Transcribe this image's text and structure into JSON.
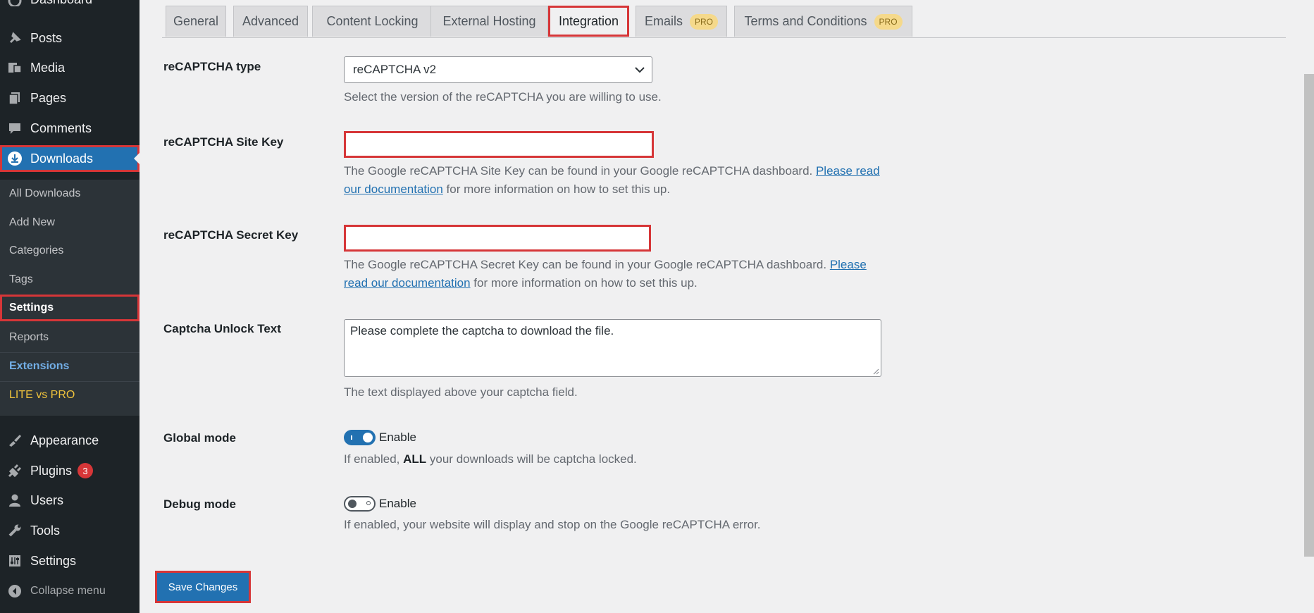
{
  "sidebar": {
    "items": [
      {
        "label": "Dashboard",
        "icon": "dashboard-icon"
      },
      {
        "label": "Posts",
        "icon": "pin-icon"
      },
      {
        "label": "Media",
        "icon": "media-icon"
      },
      {
        "label": "Pages",
        "icon": "pages-icon"
      },
      {
        "label": "Comments",
        "icon": "comment-icon"
      },
      {
        "label": "Downloads",
        "icon": "download-icon"
      },
      {
        "label": "Appearance",
        "icon": "brush-icon"
      },
      {
        "label": "Plugins",
        "icon": "plug-icon",
        "badge": "3"
      },
      {
        "label": "Users",
        "icon": "user-icon"
      },
      {
        "label": "Tools",
        "icon": "wrench-icon"
      },
      {
        "label": "Settings",
        "icon": "settings-icon"
      },
      {
        "label": "Collapse menu",
        "icon": "collapse-icon"
      }
    ],
    "submenu": [
      "All Downloads",
      "Add New",
      "Categories",
      "Tags",
      "Settings",
      "Reports",
      "Extensions",
      "LITE vs PRO"
    ]
  },
  "tabs": [
    {
      "label": "General"
    },
    {
      "label": "Advanced"
    },
    {
      "label": "Content Locking"
    },
    {
      "label": "External Hosting"
    },
    {
      "label": "Integration"
    },
    {
      "label": "Emails",
      "pro": "PRO"
    },
    {
      "label": "Terms and Conditions",
      "pro": "PRO"
    }
  ],
  "form": {
    "recaptcha_type": {
      "label": "reCAPTCHA type",
      "value": "reCAPTCHA v2",
      "desc": "Select the version of the reCAPTCHA you are willing to use."
    },
    "site_key": {
      "label": "reCAPTCHA Site Key",
      "value": "",
      "desc_before": "The Google reCAPTCHA Site Key can be found in your Google reCAPTCHA dashboard. ",
      "link_a": "Please read",
      "link_b": "our documentation",
      "desc_after": " for more information on how to set this up."
    },
    "secret_key": {
      "label": "reCAPTCHA Secret Key",
      "value": "",
      "desc_before": "The Google reCAPTCHA Secret Key can be found in your Google reCAPTCHA dashboard. ",
      "link_a": "Please",
      "link_b": "read our documentation",
      "desc_after": " for more information on how to set this up."
    },
    "unlock_text": {
      "label": "Captcha Unlock Text",
      "value": "Please complete the captcha to download the file.",
      "desc": "The text displayed above your captcha field."
    },
    "global_mode": {
      "label": "Global mode",
      "toggle_label": "Enable",
      "desc_before": "If enabled, ",
      "desc_bold": "ALL",
      "desc_after": " your downloads will be captcha locked.",
      "enabled": true
    },
    "debug_mode": {
      "label": "Debug mode",
      "toggle_label": "Enable",
      "desc": "If enabled, your website will display and stop on the Google reCAPTCHA error.",
      "enabled": false
    }
  },
  "save_label": "Save Changes"
}
